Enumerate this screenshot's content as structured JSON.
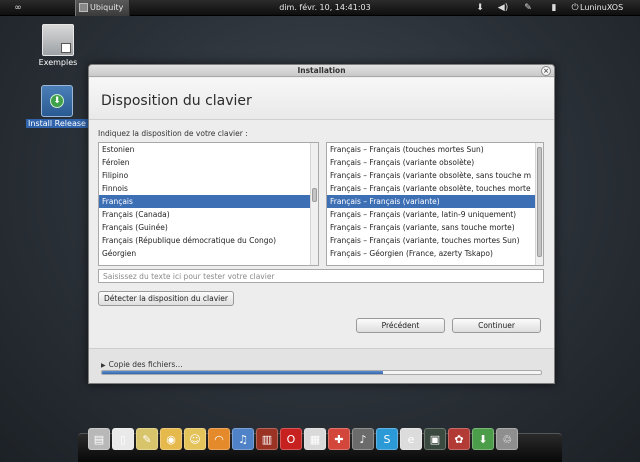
{
  "top_panel": {
    "app_name": "Ubiquity",
    "clock": "dim. févr. 10, 14:41:03",
    "user": "LuninuXOS",
    "icons": [
      "infinity-logo-icon",
      "apple-logo-icon",
      "download-icon",
      "volume-icon",
      "pen-icon",
      "battery-icon",
      "power-icon"
    ]
  },
  "desktop": {
    "icons": [
      {
        "label": "Exemples",
        "icon": "folder-shortcut-icon"
      },
      {
        "label": "Install Release",
        "icon": "installer-icon"
      }
    ]
  },
  "window": {
    "title": "Installation",
    "page_title": "Disposition du clavier",
    "instruction": "Indiquez la disposition de votre clavier :",
    "layouts": {
      "items": [
        "Estonien",
        "Féroïen",
        "Filipino",
        "Finnois",
        "Français",
        "Français (Canada)",
        "Français (Guinée)",
        "Français (République démocratique du Congo)",
        "Géorgien"
      ],
      "selected": "Français"
    },
    "variants": {
      "items": [
        "Français – Français (touches mortes Sun)",
        "Français – Français (variante obsolète)",
        "Français – Français (variante obsolète, sans touche m",
        "Français – Français (variante obsolète, touches morte",
        "Français – Français (variante)",
        "Français – Français (variante, latin-9 uniquement)",
        "Français – Français (variante, sans touche morte)",
        "Français – Français (variante, touches mortes Sun)",
        "Français – Géorgien (France, azerty Tskapo)"
      ],
      "selected": "Français – Français (variante)"
    },
    "test_placeholder": "Saisissez du texte ici pour tester votre clavier",
    "detect_label": "Détecter la disposition du clavier",
    "back_label": "Précédent",
    "continue_label": "Continuer",
    "progress": {
      "label": "Copie des fichiers…",
      "fraction": 0.64
    }
  },
  "dock": {
    "items": [
      {
        "icon": "files-icon",
        "color": "#b8b8b8"
      },
      {
        "icon": "document-icon",
        "color": "#e9e9e9"
      },
      {
        "icon": "notes-icon",
        "color": "#d8c46a"
      },
      {
        "icon": "cheese-icon",
        "color": "#e6b94c"
      },
      {
        "icon": "contacts-icon",
        "color": "#e4c35b"
      },
      {
        "icon": "rss-icon",
        "color": "#e58a2a"
      },
      {
        "icon": "beatbox-icon",
        "color": "#4f82c6"
      },
      {
        "icon": "book-icon",
        "color": "#9b3325"
      },
      {
        "icon": "opera-icon",
        "color": "#c6201f"
      },
      {
        "icon": "photos-icon",
        "color": "#d9d9d9"
      },
      {
        "icon": "puzzle-icon",
        "color": "#d2463c"
      },
      {
        "icon": "microphone-icon",
        "color": "#6b6b6b"
      },
      {
        "icon": "skype-icon",
        "color": "#2d9ad8"
      },
      {
        "icon": "ie-browser-icon",
        "color": "#dcdcdc"
      },
      {
        "icon": "terminal-icon",
        "color": "#3b4a3f"
      },
      {
        "icon": "settings-icon",
        "color": "#b23b36"
      },
      {
        "icon": "installer-icon",
        "color": "#4c9d4a"
      },
      {
        "icon": "trash-icon",
        "color": "#8f8f8f"
      }
    ]
  }
}
